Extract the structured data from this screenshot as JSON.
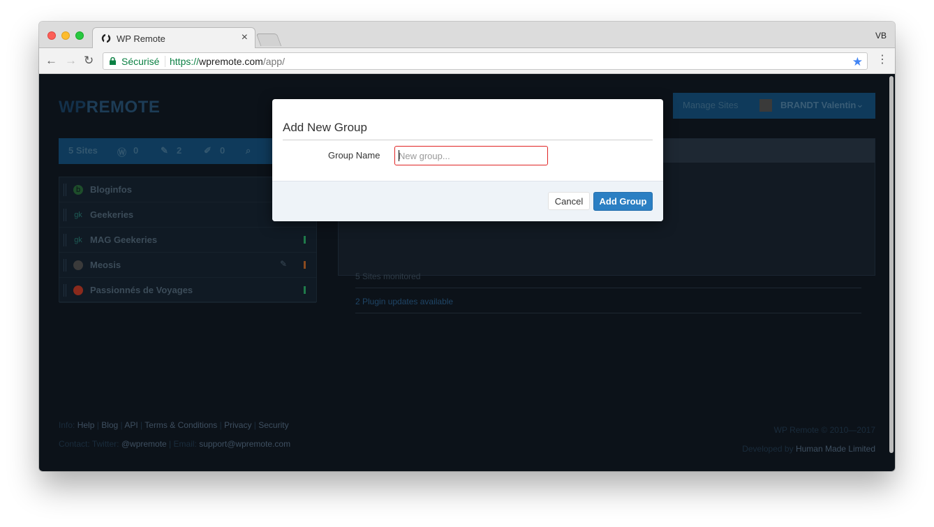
{
  "browser": {
    "tab_title": "WP Remote",
    "tab_close": "×",
    "profile": "VB",
    "secure_label": "Sécurisé",
    "url_scheme": "https://",
    "url_host": "wpremote.com",
    "url_path": "/app/"
  },
  "header": {
    "logo_prefix": "WP",
    "logo_suffix": "REMOTE",
    "manage_sites": "Manage Sites",
    "user_name": "BRANDT Valentin"
  },
  "sites_bar": {
    "sites_label": "5 Sites",
    "wp_updates": "0",
    "plugin_updates": "2",
    "theme_updates": "0"
  },
  "sites": [
    {
      "name": "Bloginfos",
      "icon": "b"
    },
    {
      "name": "Geekeries",
      "icon": "gk"
    },
    {
      "name": "MAG Geekeries",
      "icon": "gk"
    },
    {
      "name": "Meosis",
      "icon": ""
    },
    {
      "name": "Passionnés de Voyages",
      "icon": ""
    }
  ],
  "overview": {
    "monitored": "5 Sites monitored",
    "plugin_updates": "2 Plugin updates available"
  },
  "footer": {
    "info_label": "Info:",
    "help": "Help",
    "blog": "Blog",
    "api": "API",
    "terms": "Terms & Conditions",
    "privacy": "Privacy",
    "security": "Security",
    "contact_label": "Contact:",
    "twitter_label": "Twitter:",
    "twitter": "@wpremote",
    "email_label": "Email:",
    "email": "support@wpremote.com",
    "copyright": "WP Remote © 2010—2017",
    "developed_by": "Developed by",
    "developer": "Human Made Limited"
  },
  "modal": {
    "title": "Add New Group",
    "field_label": "Group Name",
    "placeholder": "New group...",
    "cancel": "Cancel",
    "submit": "Add Group"
  }
}
